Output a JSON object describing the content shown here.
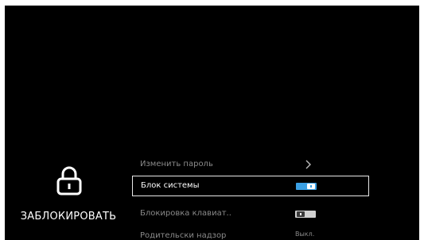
{
  "lock_panel": {
    "icon": "lock-icon",
    "label": "ЗАБЛОКИРОВАТЬ"
  },
  "menu": {
    "items": [
      {
        "label": "Изменить пароль",
        "control": "chevron-right-icon",
        "focused": false
      },
      {
        "label": "Блок системы",
        "control": "toggle",
        "toggle_state": "on",
        "focused": true
      },
      {
        "label": "Блокировка клавиат..",
        "control": "toggle",
        "toggle_state": "off",
        "focused": false
      },
      {
        "label": "Родительски надзор",
        "control": "value",
        "value": "Выкл.",
        "focused": false
      }
    ]
  },
  "colors": {
    "background": "#000000",
    "toggle_on": "#3aa0e4",
    "text_dim": "#8a8a8a",
    "text_bright": "#ffffff"
  }
}
